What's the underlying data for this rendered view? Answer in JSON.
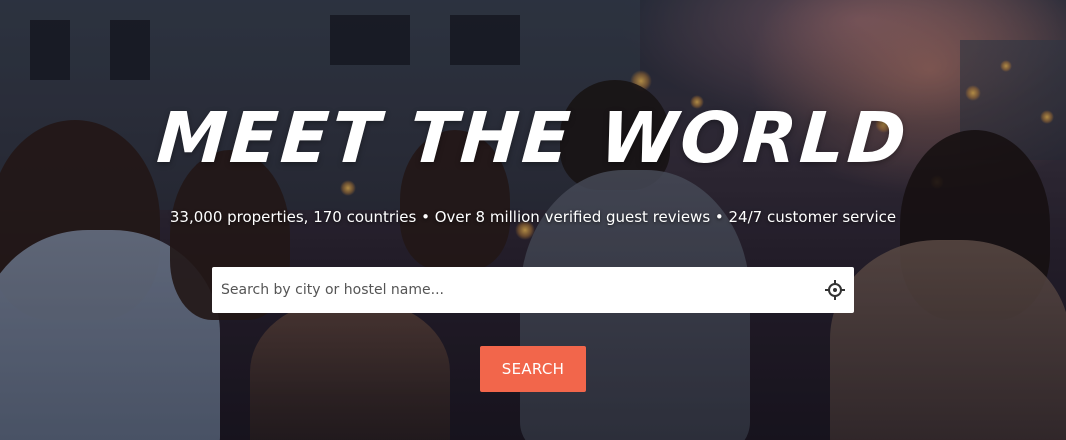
{
  "hero": {
    "headline": "MEET THE WORLD",
    "subline": "33,000 properties, 170 countries • Over 8 million verified guest reviews • 24/7 customer service"
  },
  "search": {
    "placeholder": "Search by city or hostel name...",
    "value": "",
    "locate_icon": "crosshair-locate-icon",
    "button_label": "SEARCH"
  },
  "colors": {
    "accent": "#f2664b",
    "text": "#ffffff",
    "input_bg": "#ffffff"
  }
}
